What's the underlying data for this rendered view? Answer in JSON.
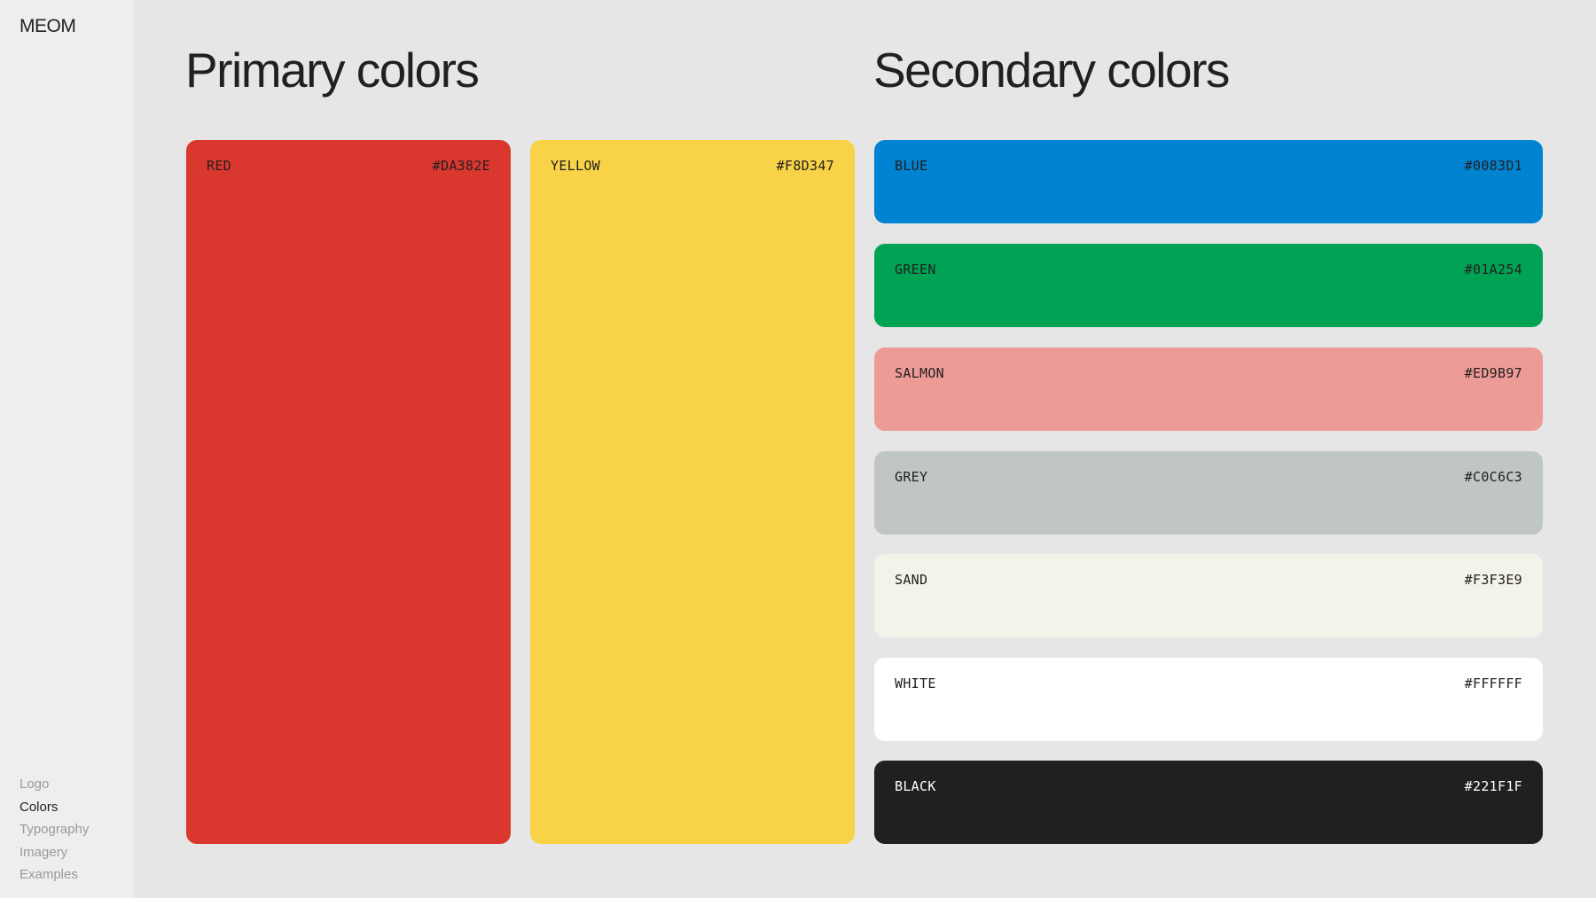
{
  "app": {
    "logo": "MEOM"
  },
  "nav": {
    "items": [
      "Logo",
      "Colors",
      "Typography",
      "Imagery",
      "Examples"
    ],
    "active": "Colors"
  },
  "primary": {
    "title": "Primary colors",
    "swatches": [
      {
        "name": "RED",
        "hex": "#DA382E",
        "text_color": "#221F1F"
      },
      {
        "name": "YELLOW",
        "hex": "#F8D347",
        "text_color": "#221F1F"
      }
    ]
  },
  "secondary": {
    "title": "Secondary colors",
    "swatches": [
      {
        "name": "BLUE",
        "hex": "#0083D1",
        "text_color": "#221F1F"
      },
      {
        "name": "GREEN",
        "hex": "#01A254",
        "text_color": "#221F1F"
      },
      {
        "name": "SALMON",
        "hex": "#ED9B97",
        "text_color": "#221F1F"
      },
      {
        "name": "GREY",
        "hex": "#C0C6C3",
        "text_color": "#221F1F"
      },
      {
        "name": "SAND",
        "hex": "#F3F3E9",
        "text_color": "#221F1F"
      },
      {
        "name": "WHITE",
        "hex": "#FFFFFF",
        "text_color": "#221F1F"
      },
      {
        "name": "BLACK",
        "hex": "#221F1F",
        "text_color": "#FFFFFF"
      }
    ]
  },
  "colors": {
    "page_background": "#E6E6E6",
    "sidebar_background": "#EEEEEE",
    "nav_inactive": "#9A9A9A",
    "nav_active": "#221F1F"
  }
}
